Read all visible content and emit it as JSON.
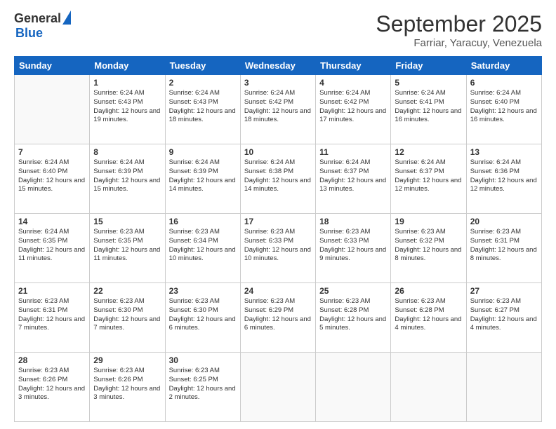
{
  "logo": {
    "general": "General",
    "blue": "Blue"
  },
  "header": {
    "month": "September 2025",
    "location": "Farriar, Yaracuy, Venezuela"
  },
  "weekdays": [
    "Sunday",
    "Monday",
    "Tuesday",
    "Wednesday",
    "Thursday",
    "Friday",
    "Saturday"
  ],
  "weeks": [
    [
      {
        "day": "",
        "sunrise": "",
        "sunset": "",
        "daylight": ""
      },
      {
        "day": "1",
        "sunrise": "Sunrise: 6:24 AM",
        "sunset": "Sunset: 6:43 PM",
        "daylight": "Daylight: 12 hours and 19 minutes."
      },
      {
        "day": "2",
        "sunrise": "Sunrise: 6:24 AM",
        "sunset": "Sunset: 6:43 PM",
        "daylight": "Daylight: 12 hours and 18 minutes."
      },
      {
        "day": "3",
        "sunrise": "Sunrise: 6:24 AM",
        "sunset": "Sunset: 6:42 PM",
        "daylight": "Daylight: 12 hours and 18 minutes."
      },
      {
        "day": "4",
        "sunrise": "Sunrise: 6:24 AM",
        "sunset": "Sunset: 6:42 PM",
        "daylight": "Daylight: 12 hours and 17 minutes."
      },
      {
        "day": "5",
        "sunrise": "Sunrise: 6:24 AM",
        "sunset": "Sunset: 6:41 PM",
        "daylight": "Daylight: 12 hours and 16 minutes."
      },
      {
        "day": "6",
        "sunrise": "Sunrise: 6:24 AM",
        "sunset": "Sunset: 6:40 PM",
        "daylight": "Daylight: 12 hours and 16 minutes."
      }
    ],
    [
      {
        "day": "7",
        "sunrise": "Sunrise: 6:24 AM",
        "sunset": "Sunset: 6:40 PM",
        "daylight": "Daylight: 12 hours and 15 minutes."
      },
      {
        "day": "8",
        "sunrise": "Sunrise: 6:24 AM",
        "sunset": "Sunset: 6:39 PM",
        "daylight": "Daylight: 12 hours and 15 minutes."
      },
      {
        "day": "9",
        "sunrise": "Sunrise: 6:24 AM",
        "sunset": "Sunset: 6:39 PM",
        "daylight": "Daylight: 12 hours and 14 minutes."
      },
      {
        "day": "10",
        "sunrise": "Sunrise: 6:24 AM",
        "sunset": "Sunset: 6:38 PM",
        "daylight": "Daylight: 12 hours and 14 minutes."
      },
      {
        "day": "11",
        "sunrise": "Sunrise: 6:24 AM",
        "sunset": "Sunset: 6:37 PM",
        "daylight": "Daylight: 12 hours and 13 minutes."
      },
      {
        "day": "12",
        "sunrise": "Sunrise: 6:24 AM",
        "sunset": "Sunset: 6:37 PM",
        "daylight": "Daylight: 12 hours and 12 minutes."
      },
      {
        "day": "13",
        "sunrise": "Sunrise: 6:24 AM",
        "sunset": "Sunset: 6:36 PM",
        "daylight": "Daylight: 12 hours and 12 minutes."
      }
    ],
    [
      {
        "day": "14",
        "sunrise": "Sunrise: 6:24 AM",
        "sunset": "Sunset: 6:35 PM",
        "daylight": "Daylight: 12 hours and 11 minutes."
      },
      {
        "day": "15",
        "sunrise": "Sunrise: 6:23 AM",
        "sunset": "Sunset: 6:35 PM",
        "daylight": "Daylight: 12 hours and 11 minutes."
      },
      {
        "day": "16",
        "sunrise": "Sunrise: 6:23 AM",
        "sunset": "Sunset: 6:34 PM",
        "daylight": "Daylight: 12 hours and 10 minutes."
      },
      {
        "day": "17",
        "sunrise": "Sunrise: 6:23 AM",
        "sunset": "Sunset: 6:33 PM",
        "daylight": "Daylight: 12 hours and 10 minutes."
      },
      {
        "day": "18",
        "sunrise": "Sunrise: 6:23 AM",
        "sunset": "Sunset: 6:33 PM",
        "daylight": "Daylight: 12 hours and 9 minutes."
      },
      {
        "day": "19",
        "sunrise": "Sunrise: 6:23 AM",
        "sunset": "Sunset: 6:32 PM",
        "daylight": "Daylight: 12 hours and 8 minutes."
      },
      {
        "day": "20",
        "sunrise": "Sunrise: 6:23 AM",
        "sunset": "Sunset: 6:31 PM",
        "daylight": "Daylight: 12 hours and 8 minutes."
      }
    ],
    [
      {
        "day": "21",
        "sunrise": "Sunrise: 6:23 AM",
        "sunset": "Sunset: 6:31 PM",
        "daylight": "Daylight: 12 hours and 7 minutes."
      },
      {
        "day": "22",
        "sunrise": "Sunrise: 6:23 AM",
        "sunset": "Sunset: 6:30 PM",
        "daylight": "Daylight: 12 hours and 7 minutes."
      },
      {
        "day": "23",
        "sunrise": "Sunrise: 6:23 AM",
        "sunset": "Sunset: 6:30 PM",
        "daylight": "Daylight: 12 hours and 6 minutes."
      },
      {
        "day": "24",
        "sunrise": "Sunrise: 6:23 AM",
        "sunset": "Sunset: 6:29 PM",
        "daylight": "Daylight: 12 hours and 6 minutes."
      },
      {
        "day": "25",
        "sunrise": "Sunrise: 6:23 AM",
        "sunset": "Sunset: 6:28 PM",
        "daylight": "Daylight: 12 hours and 5 minutes."
      },
      {
        "day": "26",
        "sunrise": "Sunrise: 6:23 AM",
        "sunset": "Sunset: 6:28 PM",
        "daylight": "Daylight: 12 hours and 4 minutes."
      },
      {
        "day": "27",
        "sunrise": "Sunrise: 6:23 AM",
        "sunset": "Sunset: 6:27 PM",
        "daylight": "Daylight: 12 hours and 4 minutes."
      }
    ],
    [
      {
        "day": "28",
        "sunrise": "Sunrise: 6:23 AM",
        "sunset": "Sunset: 6:26 PM",
        "daylight": "Daylight: 12 hours and 3 minutes."
      },
      {
        "day": "29",
        "sunrise": "Sunrise: 6:23 AM",
        "sunset": "Sunset: 6:26 PM",
        "daylight": "Daylight: 12 hours and 3 minutes."
      },
      {
        "day": "30",
        "sunrise": "Sunrise: 6:23 AM",
        "sunset": "Sunset: 6:25 PM",
        "daylight": "Daylight: 12 hours and 2 minutes."
      },
      {
        "day": "",
        "sunrise": "",
        "sunset": "",
        "daylight": ""
      },
      {
        "day": "",
        "sunrise": "",
        "sunset": "",
        "daylight": ""
      },
      {
        "day": "",
        "sunrise": "",
        "sunset": "",
        "daylight": ""
      },
      {
        "day": "",
        "sunrise": "",
        "sunset": "",
        "daylight": ""
      }
    ]
  ]
}
